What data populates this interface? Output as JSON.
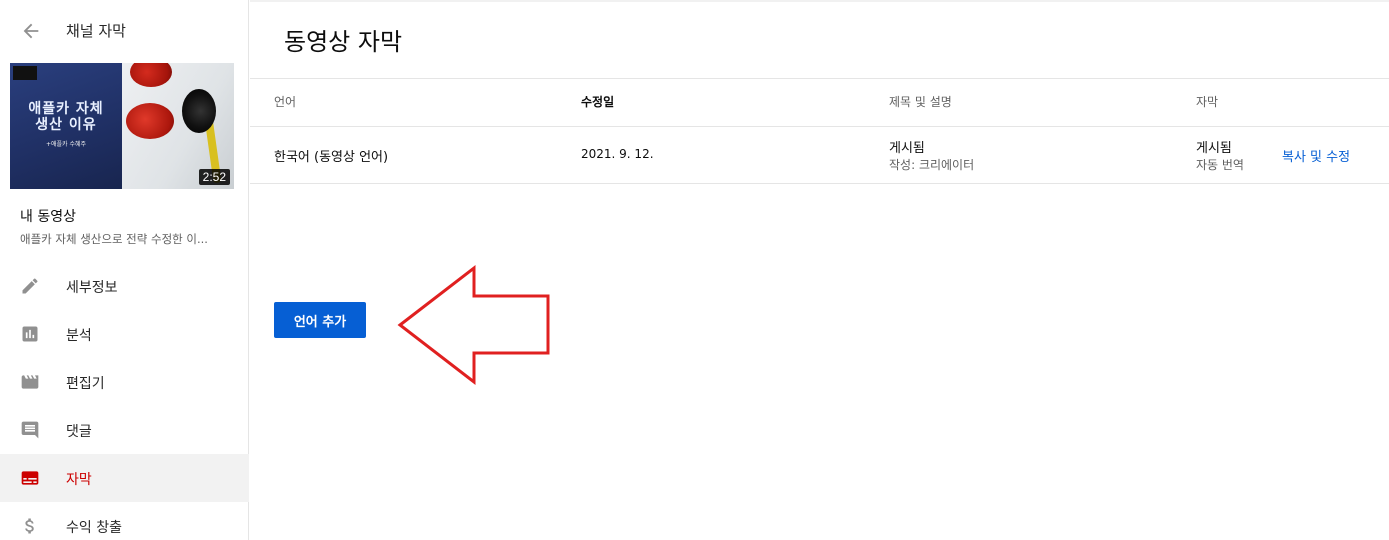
{
  "sidebar": {
    "back_label": "채널 자막",
    "thumbnail": {
      "title_line1": "애플카 자체",
      "title_line2": "생산 이유",
      "subtitle": "+애플카 수혜주",
      "duration": "2:52"
    },
    "my_video_label": "내 동영상",
    "video_title": "애플카 자체 생산으로 전략 수정한 이...",
    "nav": [
      {
        "label": "세부정보",
        "icon": "pencil-icon"
      },
      {
        "label": "분석",
        "icon": "analytics-icon"
      },
      {
        "label": "편집기",
        "icon": "clapperboard-icon"
      },
      {
        "label": "댓글",
        "icon": "comment-icon"
      },
      {
        "label": "자막",
        "icon": "subtitles-icon",
        "active": true
      },
      {
        "label": "수익 창출",
        "icon": "dollar-icon"
      }
    ]
  },
  "main": {
    "title": "동영상 자막",
    "table": {
      "headers": {
        "language": "언어",
        "modified": "수정일",
        "title_desc": "제목 및 설명",
        "subtitles": "자막"
      },
      "rows": [
        {
          "language": "한국어 (동영상 언어)",
          "modified": "2021. 9. 12.",
          "title_status": "게시됨",
          "title_author": "작성: 크리에이터",
          "sub_status": "게시됨",
          "sub_type": "자동 번역",
          "action": "복사 및 수정"
        }
      ]
    },
    "add_language_label": "언어 추가"
  },
  "colors": {
    "accent_blue": "#065fd4",
    "active_red": "#cc0000",
    "arrow_red": "#e02020"
  }
}
